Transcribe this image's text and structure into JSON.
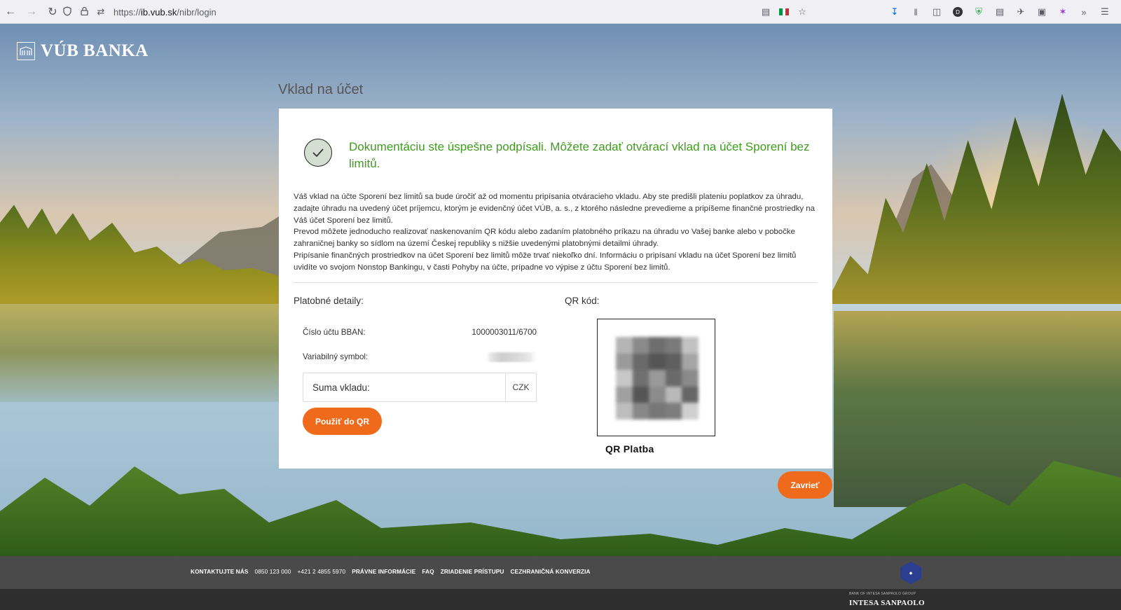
{
  "browser": {
    "url_prefix": "https://",
    "url_host": "ib.vub.sk",
    "url_path": "/nibr/login"
  },
  "brand": {
    "logo_text": "VÚB BANKA",
    "accent_color": "#f06a1c",
    "success_color": "#3f9c1f"
  },
  "page": {
    "title": "Vklad na účet"
  },
  "card": {
    "success_message": "Dokumentáciu ste úspešne podpísali. Môžete zadať otvárací vklad na účet Sporení bez limitů.",
    "info_paragraphs": [
      "Váš vklad na účte Sporení bez limitů sa bude úročiť až od momentu pripísania otváracieho vkladu. Aby ste predišli plateniu poplatkov za úhradu, zadajte úhradu na uvedený účet príjemcu, ktorým je evidenčný účet VÚB, a. s., z ktorého následne prevedieme a pripíšeme finančné prostriedky na Váš účet Sporení bez limitů.",
      "Prevod môžete jednoducho realizovať naskenovaním QR kódu alebo zadaním platobného príkazu na úhradu vo Vašej banke alebo v pobočke zahraničnej banky so sídlom na území Českej republiky s nižšie uvedenými platobnými detailmi úhrady.",
      "Pripísanie finančných prostriedkov na účet Sporení bez limitů môže trvať niekoľko dní. Informáciu o pripísaní vkladu na účet Sporení bez limitů uvidíte vo svojom Nonstop Bankingu, v časti Pohyby na účte, prípadne vo výpise z účtu Sporení bez limitů."
    ],
    "payment_details_label": "Platobné detaily:",
    "account_label": "Číslo účtu BBAN:",
    "account_value": "1000003011/6700",
    "vs_label": "Variabilný symbol:",
    "amount_placeholder": "Suma vkladu:",
    "currency": "CZK",
    "use_qr_button": "Použiť do QR",
    "qr_label": "QR kód:",
    "qr_caption": "QR Platba"
  },
  "close_button": "Zavrieť",
  "footer": {
    "links": [
      {
        "label": "KONTAKTUJTE NÁS",
        "bold": true
      },
      {
        "label": "0850 123 000",
        "bold": false
      },
      {
        "label": "+421 2 4855 5970",
        "bold": false
      },
      {
        "label": "PRÁVNE INFORMÁCIE",
        "bold": true
      },
      {
        "label": "FAQ",
        "bold": true
      },
      {
        "label": "ZRIADENIE PRÍSTUPU",
        "bold": true
      },
      {
        "label": "CEZHRANIČNÁ KONVERZIA",
        "bold": true
      }
    ],
    "group_small": "BANK OF INTESA SANPAOLO GROUP",
    "group_name": "INTESA SANPAOLO"
  }
}
